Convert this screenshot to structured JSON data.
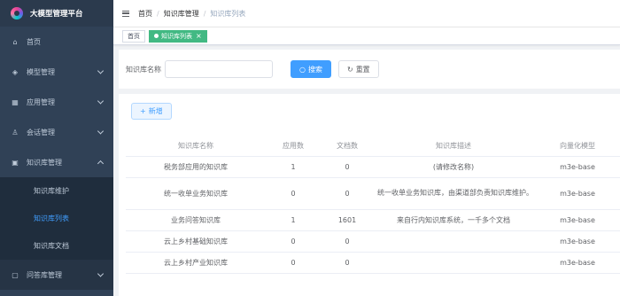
{
  "brand": {
    "title": "大模型管理平台"
  },
  "sidebar": {
    "items": [
      {
        "label": "首页",
        "icon": "home-icon"
      },
      {
        "label": "模型管理",
        "icon": "cube-icon"
      },
      {
        "label": "应用管理",
        "icon": "grid-icon"
      },
      {
        "label": "会话管理",
        "icon": "user-icon"
      },
      {
        "label": "知识库管理",
        "icon": "folder-icon"
      },
      {
        "label": "问答库管理",
        "icon": "chat-icon"
      }
    ],
    "sub_items": [
      {
        "label": "知识库维护"
      },
      {
        "label": "知识库列表"
      },
      {
        "label": "知识库文档"
      }
    ]
  },
  "breadcrumb": {
    "home": "首页",
    "section": "知识库管理",
    "current": "知识库列表"
  },
  "tags": {
    "home": "首页",
    "active": "知识库列表"
  },
  "search": {
    "label": "知识库名称",
    "placeholder": "",
    "search_button": "搜索",
    "reset_button": "重置"
  },
  "toolbar": {
    "add_label": "新增"
  },
  "table": {
    "headers": [
      "知识库名称",
      "应用数",
      "文档数",
      "知识库描述",
      "向量化模型"
    ],
    "rows": [
      {
        "name": "税务部应用的知识库",
        "apps": "1",
        "docs": "0",
        "desc": "(请修改名称)",
        "model": "m3e-base"
      },
      {
        "name": "统一收单业务知识库",
        "apps": "0",
        "docs": "0",
        "desc": "统一收单业务知识库，由渠道部负责知识库维护。",
        "model": "m3e-base"
      },
      {
        "name": "业务问答知识库",
        "apps": "1",
        "docs": "1601",
        "desc": "来自行内知识库系统，一千多个文档",
        "model": "m3e-base"
      },
      {
        "name": "云上乡村基础知识库",
        "apps": "0",
        "docs": "0",
        "desc": "",
        "model": "m3e-base"
      },
      {
        "name": "云上乡村产业知识库",
        "apps": "0",
        "docs": "0",
        "desc": "",
        "model": "m3e-base"
      }
    ]
  },
  "colors": {
    "sidebar_bg": "#304156",
    "accent": "#409eff",
    "tag_active": "#42b983"
  }
}
